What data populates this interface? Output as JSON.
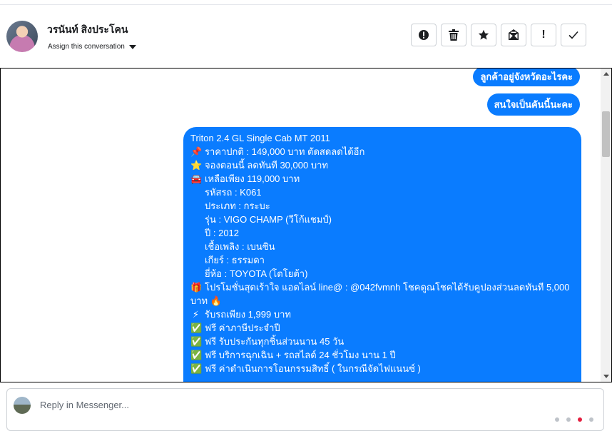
{
  "header": {
    "contact_name": "วรนันท์ สิงประโคน",
    "assign_label": "Assign this conversation",
    "actions": [
      {
        "name": "spam-button",
        "icon": "alert-circle-icon"
      },
      {
        "name": "delete-button",
        "icon": "trash-icon"
      },
      {
        "name": "star-button",
        "icon": "star-icon"
      },
      {
        "name": "mark-unread-button",
        "icon": "envelope-icon"
      },
      {
        "name": "follow-up-button",
        "icon": "exclamation-icon",
        "label": "!"
      },
      {
        "name": "done-button",
        "icon": "check-icon"
      }
    ]
  },
  "messages": {
    "m1": "ลูกค้าอยู่จังหวัดอะไรคะ",
    "m2": "สนใจเป็นคันนี้นะคะ",
    "m3": {
      "title": "Triton 2.4 GL Single Cab MT 2011",
      "lines": [
        {
          "emoji": "📌",
          "text": "ราคาปกติ : 149,000 บาท ตัดสดลดได้อีก"
        },
        {
          "emoji": "⭐",
          "text": "จองตอนนี้ ลดทันที 30,000 บาท"
        },
        {
          "emoji": "🚘",
          "text": "เหลือเพียง 119,000 บาท"
        },
        {
          "emoji": "",
          "text": "รหัสรถ : K061"
        },
        {
          "emoji": "",
          "text": "ประเภท : กระบะ"
        },
        {
          "emoji": "",
          "text": "รุ่น : VIGO CHAMP (วีโก้แชมป์)"
        },
        {
          "emoji": "",
          "text": "ปี : 2012"
        },
        {
          "emoji": "",
          "text": "เชื้อเพลิง : เบนซิน"
        },
        {
          "emoji": "",
          "text": "เกียร์ : ธรรมดา"
        },
        {
          "emoji": "",
          "text": "ยี่ห้อ : TOYOTA (โตโยต้า)"
        },
        {
          "emoji": "🎁",
          "text": "โปรโมชั่นสุดเร้าใจ แอดไลน์ line@ : @042fvmnh โชคดูณโชคได้รับคูปองส่วนลดทันที 5,000 บาท 🔥"
        },
        {
          "emoji": "⚡",
          "text": "รับรถเพียง 1,999 บาท"
        },
        {
          "emoji": "✅",
          "text": "ฟรี ค่าภาษีประจำปี"
        },
        {
          "emoji": "✅",
          "text": "ฟรี รับประกันทุกชิ้นส่วนนาน 45 วัน"
        },
        {
          "emoji": "✅",
          "text": "ฟรี บริการฉุกเฉิน + รถสไลด์ 24 ชั่วโมง นาน 1 ปี"
        },
        {
          "emoji": "✅",
          "text": "ฟรี ค่าดำเนินการโอนกรรมสิทธิ์ ( ในกรณีจัดไฟแนนซ์ )"
        }
      ]
    }
  },
  "reply": {
    "placeholder": "Reply in Messenger..."
  },
  "colors": {
    "bubble": "#0a7cff",
    "border": "#ccd0d5"
  }
}
